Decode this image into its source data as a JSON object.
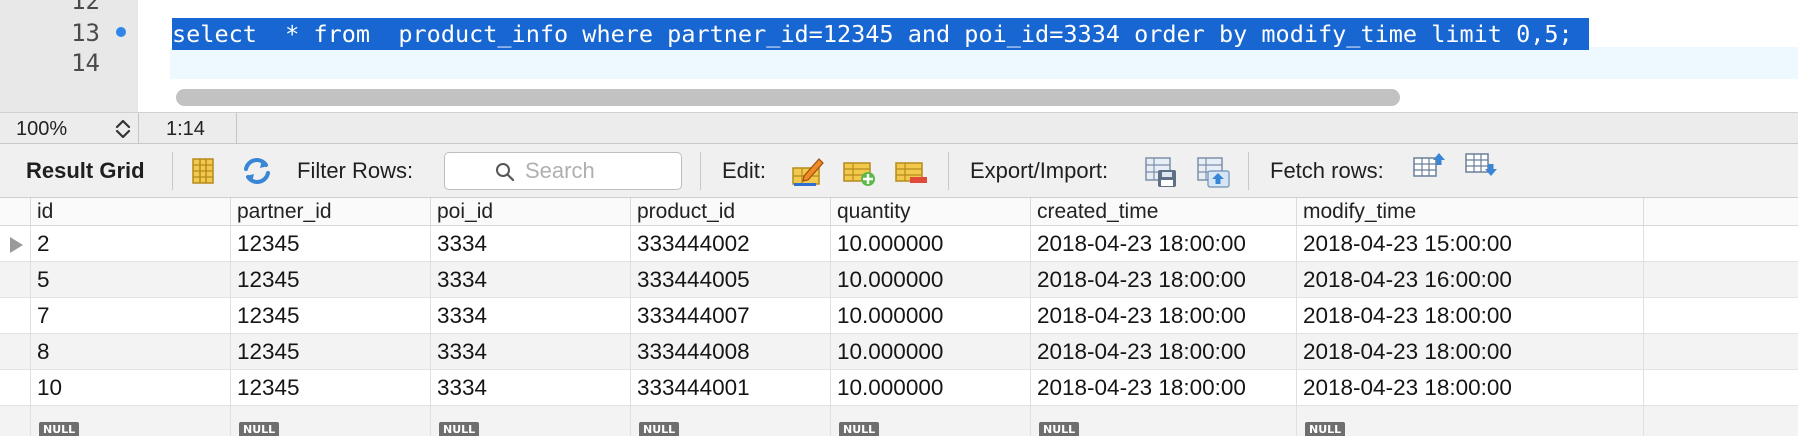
{
  "editor": {
    "line_numbers": [
      "12",
      "13",
      "14"
    ],
    "sql_line": "select  * from  product_info where partner_id=12345 and poi_id=3334 order by modify_time limit 0,5;"
  },
  "statusbar": {
    "zoom": "100%",
    "cursor_position": "1:14"
  },
  "toolbar": {
    "result_grid_label": "Result Grid",
    "filter_rows_label": "Filter Rows:",
    "search_placeholder": "Search",
    "edit_label": "Edit:",
    "export_import_label": "Export/Import:",
    "fetch_rows_label": "Fetch rows:",
    "icons": [
      "grid-form-icon",
      "refresh-icon",
      "edit-row-icon",
      "add-row-icon",
      "delete-row-icon",
      "export-icon",
      "import-icon",
      "fetch-next-icon",
      "fetch-all-icon"
    ]
  },
  "grid": {
    "columns": [
      "id",
      "partner_id",
      "poi_id",
      "product_id",
      "quantity",
      "created_time",
      "modify_time"
    ],
    "rows": [
      [
        "2",
        "12345",
        "3334",
        "333444002",
        "10.000000",
        "2018-04-23 18:00:00",
        "2018-04-23 15:00:00"
      ],
      [
        "5",
        "12345",
        "3334",
        "333444005",
        "10.000000",
        "2018-04-23 18:00:00",
        "2018-04-23 16:00:00"
      ],
      [
        "7",
        "12345",
        "3334",
        "333444007",
        "10.000000",
        "2018-04-23 18:00:00",
        "2018-04-23 18:00:00"
      ],
      [
        "8",
        "12345",
        "3334",
        "333444008",
        "10.000000",
        "2018-04-23 18:00:00",
        "2018-04-23 18:00:00"
      ],
      [
        "10",
        "12345",
        "3334",
        "333444001",
        "10.000000",
        "2018-04-23 18:00:00",
        "2018-04-23 18:00:00"
      ]
    ],
    "null_label": "NULL"
  },
  "colors": {
    "selection": "#1766d1",
    "current_line": "#eef8ff",
    "breakpoint": "#2f86e8"
  }
}
